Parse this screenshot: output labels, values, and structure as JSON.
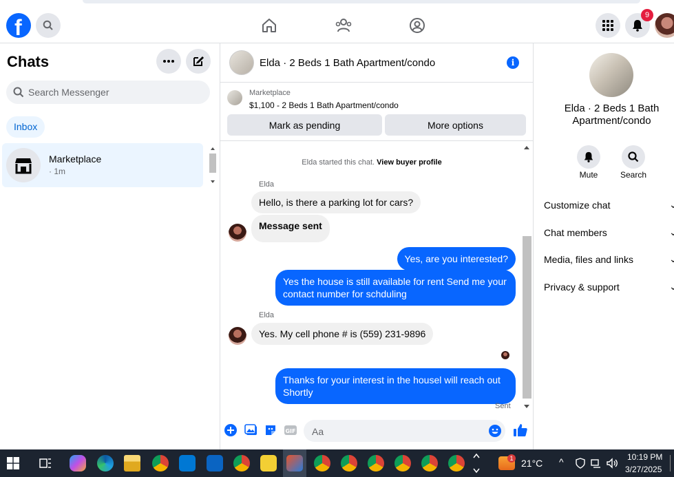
{
  "nav": {
    "logo": "f",
    "notification_count": "9",
    "icons": [
      "search-icon",
      "home-icon",
      "friends-icon",
      "groups-icon",
      "apps-grid-icon",
      "bell-icon"
    ]
  },
  "sidebar": {
    "title": "Chats",
    "search_placeholder": "Search Messenger",
    "filter_tab": "Inbox",
    "conversations": [
      {
        "name": "Marketplace",
        "time": "· 1m"
      }
    ]
  },
  "chat": {
    "header_title": "Elda · 2 Beds 1 Bath Apartment/condo",
    "listing": {
      "label": "Marketplace",
      "price_title": "$1,100 - 2 Beds 1 Bath Apartment/condo",
      "pending_button": "Mark as pending",
      "more_button": "More options"
    },
    "system_msg_plain": "Elda started this chat.",
    "system_msg_link": "View buyer profile",
    "messages": [
      {
        "sender": "Elda",
        "text": "Hello, is there a parking lot for cars?"
      },
      {
        "text": "Message sent"
      },
      {
        "text": "Yes, are you interested?"
      },
      {
        "text": "Yes the house is still available for rent Send me your contact number for schduling"
      },
      {
        "sender": "Elda",
        "text": "Yes. My cell phone # is (559) 231-9896"
      },
      {
        "text": "Thanks for your interest in the housel will reach out Shortly"
      }
    ],
    "status": "Sent",
    "composer_placeholder": "Aa"
  },
  "details": {
    "title": "Elda · 2 Beds 1 Bath Apartment/condo",
    "actions": [
      "Mute",
      "Search"
    ],
    "sections": [
      "Customize chat",
      "Chat members",
      "Media, files and links",
      "Privacy & support"
    ]
  },
  "taskbar": {
    "weather_badge": "1",
    "temperature": "21°C",
    "time": "10:19 PM",
    "date": "3/27/2025"
  },
  "colors": {
    "accent": "#0866ff",
    "bubble_in": "#f0f0f0",
    "taskbar": "#1c2430",
    "badge": "#e41e3f"
  }
}
